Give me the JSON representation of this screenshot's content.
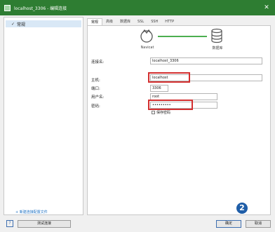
{
  "window": {
    "title": "localhost_3306 - 编辑连接"
  },
  "sidebar": {
    "items": [
      {
        "label": "常规"
      }
    ],
    "new_link": "+ 新建连接配置文件"
  },
  "tabs": [
    "常规",
    "高级",
    "数据库",
    "SSL",
    "SSH",
    "HTTP"
  ],
  "diagram": {
    "left_label": "Navicat",
    "right_label": "数据库"
  },
  "form": {
    "conn_name_label": "连接名:",
    "conn_name_value": "localhost_3306",
    "host_label": "主机:",
    "host_value": "localhost",
    "port_label": "端口:",
    "port_value": "3306",
    "user_label": "用户名:",
    "user_value": "root",
    "password_label": "密码:",
    "password_value": "•••••••••",
    "save_password_label": "保存密码"
  },
  "footer": {
    "help_icon": "?",
    "test_button": "测试连接",
    "ok_button": "确定",
    "cancel_button": "取消"
  },
  "annotation": {
    "step_number": "2"
  }
}
